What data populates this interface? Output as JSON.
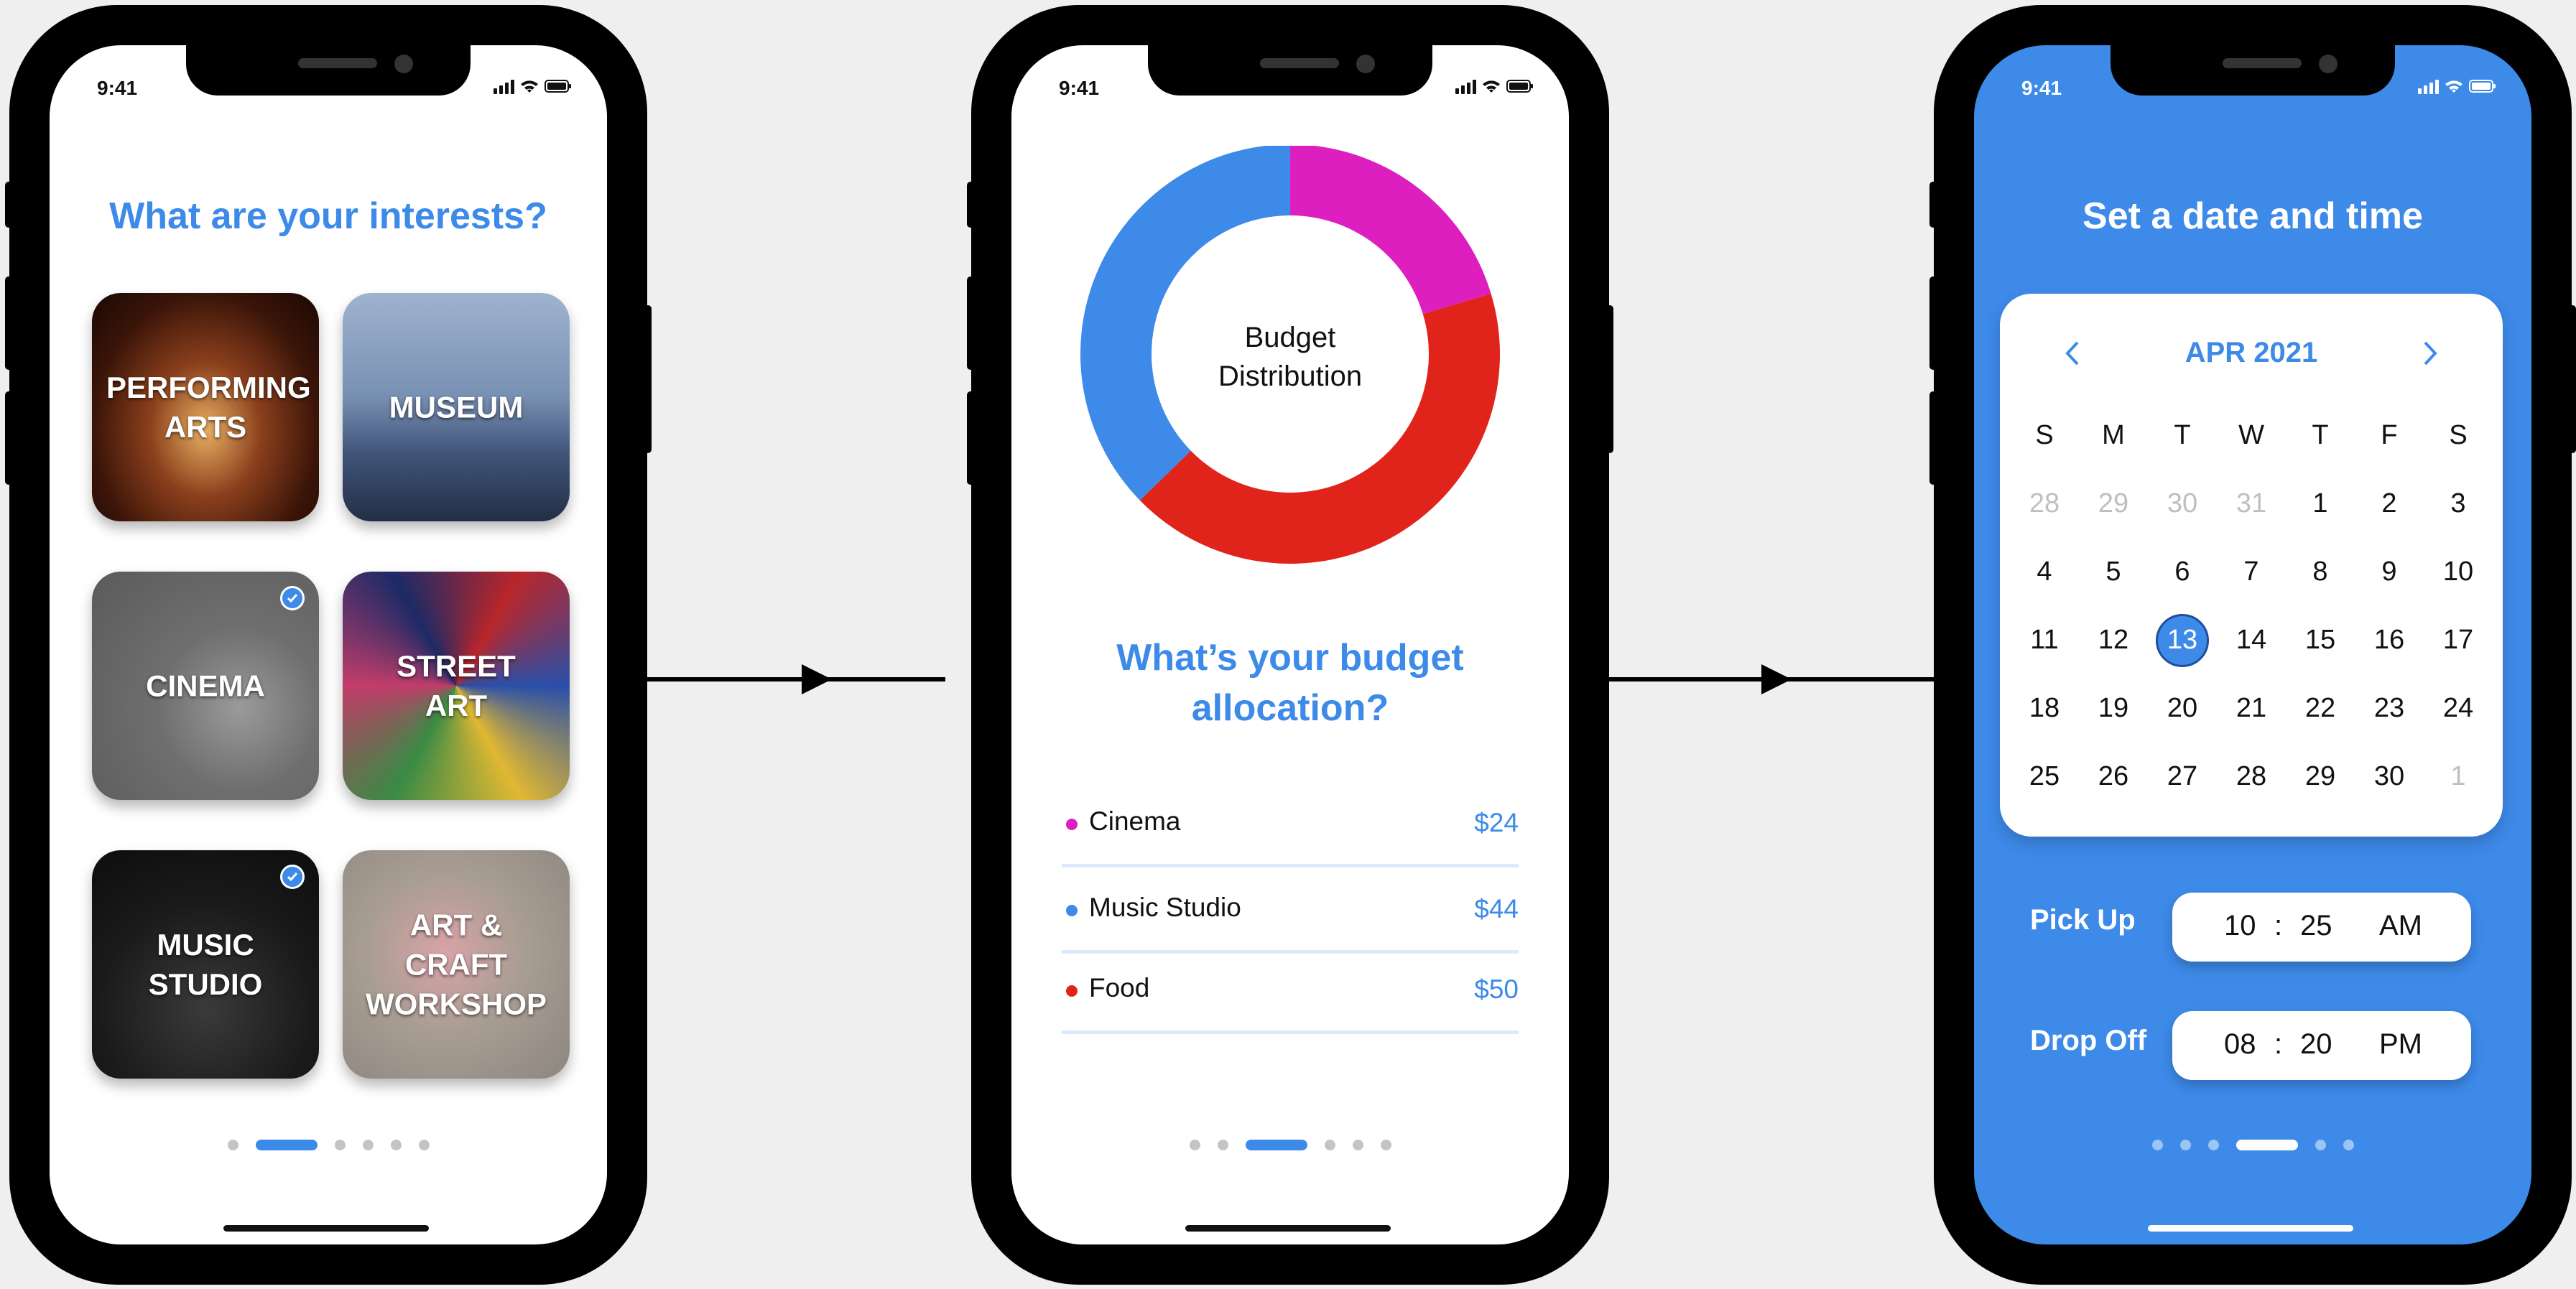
{
  "status": {
    "time": "9:41"
  },
  "screen1": {
    "title": "What are your interests?",
    "tiles": [
      {
        "label": "PERFORMING ARTS",
        "selected": false
      },
      {
        "label": "MUSEUM",
        "selected": false
      },
      {
        "label": "CINEMA",
        "selected": true
      },
      {
        "label": "STREET ART",
        "selected": true
      },
      {
        "label": "MUSIC STUDIO",
        "selected": true
      },
      {
        "label": "ART & CRAFT WORKSHOP",
        "selected": false
      }
    ],
    "page_index": 1
  },
  "screen2": {
    "donut_center_label": "Budget Distribution",
    "title": "What’s your budget allocation?",
    "items": [
      {
        "name": "Cinema",
        "amount": "$24",
        "color": "#dd1fc0"
      },
      {
        "name": "Music Studio",
        "amount": "$44",
        "color": "#3d8ae9"
      },
      {
        "name": "Food",
        "amount": "$50",
        "color": "#e0241b"
      }
    ],
    "page_index": 2
  },
  "screen3": {
    "title": "Set a date and time",
    "calendar": {
      "month": "APR 2021",
      "weekdays": [
        "S",
        "M",
        "T",
        "W",
        "T",
        "F",
        "S"
      ],
      "days": [
        "28",
        "29",
        "30",
        "31",
        "1",
        "2",
        "3",
        "4",
        "5",
        "6",
        "7",
        "8",
        "9",
        "10",
        "11",
        "12",
        "13",
        "14",
        "15",
        "16",
        "17",
        "18",
        "19",
        "20",
        "21",
        "22",
        "23",
        "24",
        "25",
        "26",
        "27",
        "28",
        "29",
        "30",
        "1"
      ],
      "muted_indices": [
        0,
        1,
        2,
        3,
        34
      ],
      "selected_day": "13"
    },
    "pickup": {
      "label": "Pick Up",
      "hour": "10",
      "minute": "25",
      "period": "AM"
    },
    "dropoff": {
      "label": "Drop Off",
      "hour": "08",
      "minute": "20",
      "period": "PM"
    },
    "page_index": 3
  },
  "colors": {
    "accent": "#3d8ae9",
    "cinema": "#dd1fc0",
    "music": "#3d8ae9",
    "food": "#e0241b"
  },
  "chart_data": {
    "type": "pie",
    "title": "Budget Distribution",
    "categories": [
      "Cinema",
      "Music Studio",
      "Food"
    ],
    "values": [
      24,
      44,
      50
    ]
  }
}
